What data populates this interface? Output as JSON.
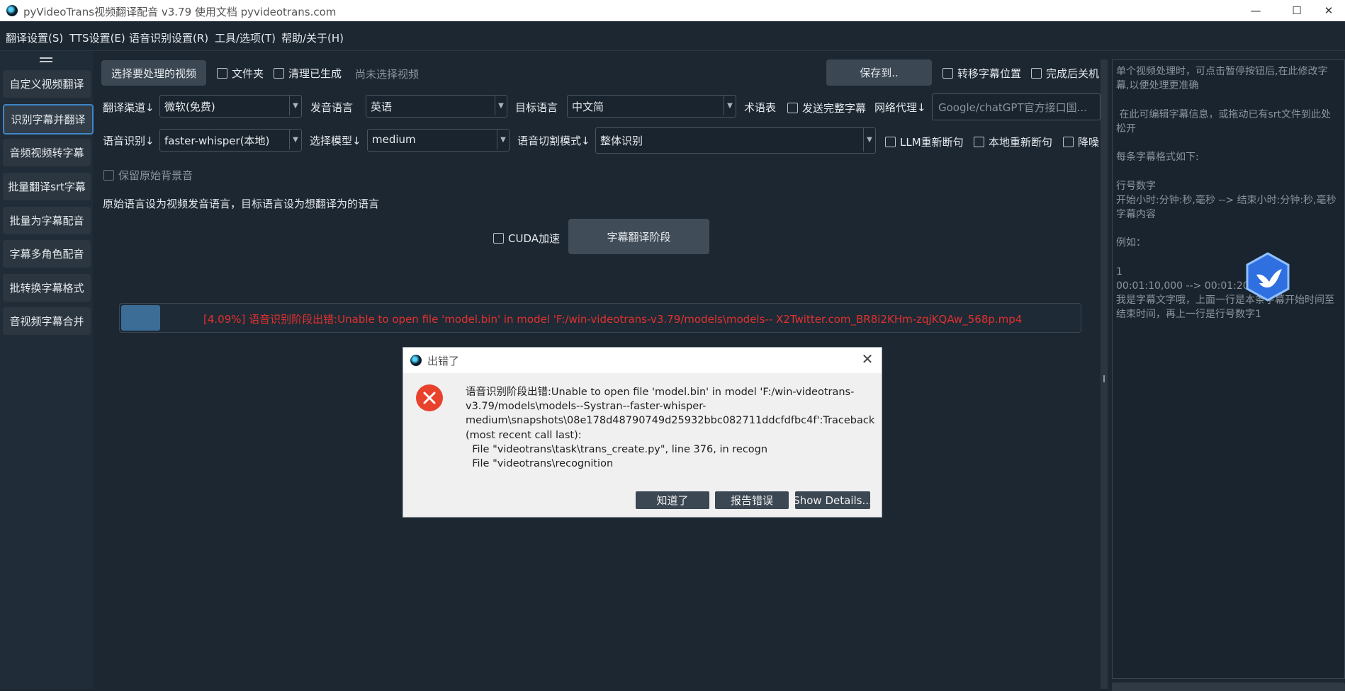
{
  "window": {
    "title": "pyVideoTrans视频翻译配音 v3.79  使用文档  pyvideotrans.com",
    "minimize_icon": "—",
    "maximize_icon": "☐",
    "close_icon": "✕"
  },
  "menu": [
    "翻译设置(S)",
    "TTS设置(E)",
    "语音识别设置(R)",
    "工具/选项(T)",
    "帮助/关于(H)"
  ],
  "sidebar": {
    "items": [
      "自定义视频翻译",
      "识别字幕并翻译",
      "音频视频转字幕",
      "批量翻译srt字幕",
      "批量为字幕配音",
      "字幕多角色配音",
      "批转换字幕格式",
      "音视频字幕合并"
    ],
    "active": "识别字幕并翻译"
  },
  "top": {
    "select_video": "选择要处理的视频",
    "folder": "文件夹",
    "clear_generated": "清理已生成",
    "no_video": "尚未选择视频",
    "save_to": "保存到..",
    "move_subtitle": "转移字幕位置",
    "shutdown_after": "完成后关机"
  },
  "row1": {
    "channel_label": "翻译渠道↓",
    "channel_value": "微软(免费)",
    "source_label": "发音语言",
    "source_value": "英语",
    "target_label": "目标语言",
    "target_value": "中文简",
    "glossary_label": "术语表",
    "send_full": "发送完整字幕",
    "proxy_label": "网络代理↓",
    "proxy_placeholder": "Google/chatGPT官方接口国..."
  },
  "row2": {
    "asr_label": "语音识别↓",
    "asr_value": "faster-whisper(本地)",
    "model_label": "选择模型↓",
    "model_value": "medium",
    "split_label": "语音切割模式↓",
    "split_value": "整体识别",
    "llm_resegment": "LLM重新断句",
    "local_resegment": "本地重新断句",
    "denoise": "降噪"
  },
  "keep_bg": "保留原始背景音",
  "hint": "原始语言设为视频发音语言，目标语言设为想翻译为的语言",
  "cuda": "CUDA加速",
  "stage_button": "字幕翻译阶段",
  "progress": {
    "percent": 4.09,
    "text": "[4.09%]  语音识别阶段出错:Unable to open file 'model.bin' in model 'F:/win-videotrans-v3.79/models\\models--   X2Twitter.com_BR8i2KHm-zqjKQAw_568p.mp4"
  },
  "right_panel": {
    "text": "单个视频处理时，可点击暂停按钮后,在此修改字\n幕,以便处理更准确\n\n 在此可编辑字幕信息，或拖动已有srt文件到此处\n松开\n\n每条字幕格式如下:\n\n行号数字\n开始小时:分钟:秒,毫秒 --> 结束小时:分钟:秒,毫秒\n字幕内容\n\n例如：\n\n1\n00:01:10,000 --> 00:01:20\n我是字幕文字哦，上面一行是本条字幕开始时间至\n结束时间，再上一行是行号数字1"
  },
  "dialog": {
    "title": "出错了",
    "message": "语音识别阶段出错:Unable to open file 'model.bin' in model 'F:/win-videotrans-\nv3.79/models\\models--Systran--faster-whisper-\nmedium\\snapshots\\08e178d48790749d25932bbc082711ddcfdfbc4f':Traceback\n(most recent call last):\n  File \"videotrans\\task\\trans_create.py\", line 376, in recogn\n  File \"videotrans\\recognition",
    "ok": "知道了",
    "report": "报告错误",
    "details": "Show Details...",
    "close_icon": "✕"
  },
  "colors": {
    "background": "#1c2732",
    "accent": "#3f86c6",
    "error": "#e0312f",
    "button": "#3b4753",
    "progress_fill": "#3b6d97"
  }
}
